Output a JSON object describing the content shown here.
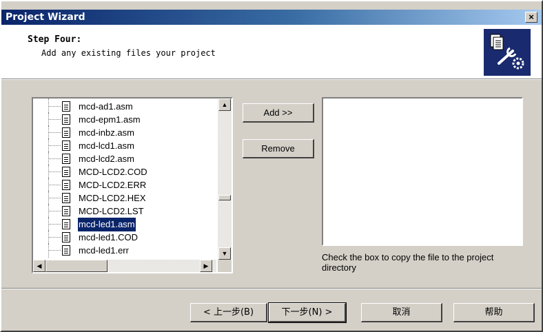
{
  "window": {
    "title": "Project Wizard",
    "close_label": "×"
  },
  "header": {
    "step_title": "Step Four:",
    "step_description": "Add any existing files your project"
  },
  "file_list": {
    "items": [
      {
        "name": "mcd-ad1.asm",
        "selected": false
      },
      {
        "name": "mcd-epm1.asm",
        "selected": false
      },
      {
        "name": "mcd-inbz.asm",
        "selected": false
      },
      {
        "name": "mcd-lcd1.asm",
        "selected": false
      },
      {
        "name": "mcd-lcd2.asm",
        "selected": false
      },
      {
        "name": "MCD-LCD2.COD",
        "selected": false
      },
      {
        "name": "MCD-LCD2.ERR",
        "selected": false
      },
      {
        "name": "MCD-LCD2.HEX",
        "selected": false
      },
      {
        "name": "MCD-LCD2.LST",
        "selected": false
      },
      {
        "name": "mcd-led1.asm",
        "selected": true
      },
      {
        "name": "mcd-led1.COD",
        "selected": false
      },
      {
        "name": "mcd-led1.err",
        "selected": false
      }
    ],
    "scroll_up": "▲",
    "scroll_down": "▼",
    "scroll_left": "◀",
    "scroll_right": "▶"
  },
  "actions": {
    "add_label": "Add >>",
    "remove_label": "Remove"
  },
  "selected_files": {
    "hint": "Check the box to copy the file to the project directory"
  },
  "footer": {
    "back_label": "< 上一步(B)",
    "next_label": "下一步(N) >",
    "cancel_label": "取消",
    "help_label": "帮助"
  },
  "colors": {
    "title_bar": "#0a246a",
    "selection": "#0a246a",
    "dialog_face": "#d4d0c8"
  }
}
